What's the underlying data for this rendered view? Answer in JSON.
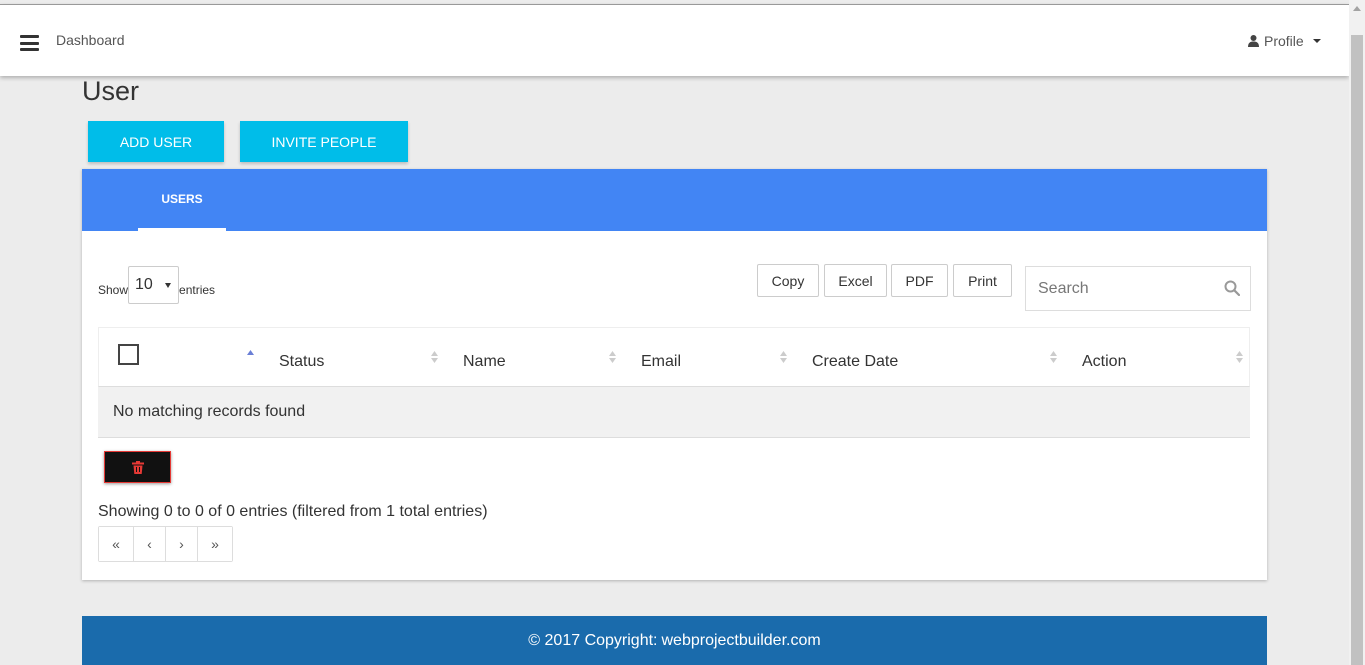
{
  "header": {
    "dashboard_label": "Dashboard",
    "profile_label": "Profile"
  },
  "page": {
    "title": "User"
  },
  "actions": {
    "add_user": "ADD USER",
    "invite_people": "INVITE PEOPLE"
  },
  "tabs": [
    {
      "label": "USERS",
      "active": true
    }
  ],
  "table_controls": {
    "show_prefix": "Show",
    "page_length": "10",
    "show_suffix": "entries",
    "export_buttons": [
      "Copy",
      "Excel",
      "PDF",
      "Print"
    ],
    "search_placeholder": "Search"
  },
  "table": {
    "columns": [
      "",
      "Status",
      "Name",
      "Email",
      "Create Date",
      "Action"
    ],
    "empty_message": "No matching records found",
    "info": "Showing 0 to 0 of 0 entries (filtered from 1 total entries)",
    "pagination": [
      "«",
      "‹",
      "›",
      "»"
    ]
  },
  "footer": {
    "copyright": "© 2017 Copyright:",
    "link": "webprojectbuilder.com"
  },
  "colors": {
    "accent_cyan": "#00bde9",
    "tab_bar_blue": "#4285f4",
    "footer_blue": "#1a6bac",
    "delete_icon_red": "#e53935"
  },
  "icons": {
    "menu": "hamburger-icon",
    "profile": "user-icon",
    "search": "search-icon",
    "delete": "trash-icon"
  }
}
